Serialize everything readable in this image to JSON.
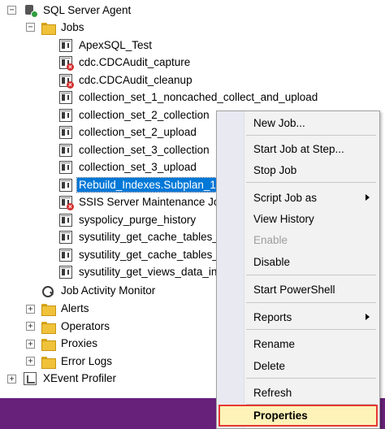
{
  "tree": {
    "agent": {
      "label": "SQL Server Agent",
      "icon": "sql-agent-icon"
    },
    "jobs_folder": {
      "label": "Jobs",
      "icon": "folder-icon"
    },
    "jobs": [
      {
        "label": "ApexSQL_Test",
        "failed": false
      },
      {
        "label": "cdc.CDCAudit_capture",
        "failed": true
      },
      {
        "label": "cdc.CDCAudit_cleanup",
        "failed": true
      },
      {
        "label": "collection_set_1_noncached_collect_and_upload",
        "failed": false
      },
      {
        "label": "collection_set_2_collection",
        "failed": false
      },
      {
        "label": "collection_set_2_upload",
        "failed": false
      },
      {
        "label": "collection_set_3_collection",
        "failed": false
      },
      {
        "label": "collection_set_3_upload",
        "failed": false
      },
      {
        "label": "Rebuild_Indexes.Subplan_1",
        "failed": false,
        "selected": true
      },
      {
        "label": "SSIS Server Maintenance Jo",
        "failed": true
      },
      {
        "label": "syspolicy_purge_history",
        "failed": false
      },
      {
        "label": "sysutility_get_cache_tables_",
        "failed": false
      },
      {
        "label": "sysutility_get_cache_tables_",
        "failed": false
      },
      {
        "label": "sysutility_get_views_data_in",
        "failed": false
      }
    ],
    "job_activity_monitor": {
      "label": "Job Activity Monitor",
      "icon": "monitor-icon"
    },
    "folders": [
      {
        "label": "Alerts"
      },
      {
        "label": "Operators"
      },
      {
        "label": "Proxies"
      },
      {
        "label": "Error Logs"
      }
    ],
    "xevent": {
      "label": "XEvent Profiler",
      "icon": "xevent-icon"
    },
    "expand_symbol": "+",
    "collapse_symbol": "−"
  },
  "context_menu": {
    "items": [
      {
        "label": "New Job...",
        "enabled": true
      },
      {
        "label": "Start Job at Step...",
        "enabled": true
      },
      {
        "label": "Stop Job",
        "enabled": true
      },
      {
        "label": "Script Job as",
        "enabled": true,
        "submenu": true
      },
      {
        "label": "View History",
        "enabled": true
      },
      {
        "label": "Enable",
        "enabled": false
      },
      {
        "label": "Disable",
        "enabled": true
      },
      {
        "label": "Start PowerShell",
        "enabled": true
      },
      {
        "label": "Reports",
        "enabled": true,
        "submenu": true
      },
      {
        "label": "Rename",
        "enabled": true
      },
      {
        "label": "Delete",
        "enabled": true
      },
      {
        "label": "Refresh",
        "enabled": true
      },
      {
        "label": "Properties",
        "enabled": true,
        "highlighted": true
      }
    ]
  },
  "colors": {
    "selection": "#0078d7",
    "highlight_border": "#e53935",
    "highlight_fill": "#fdf2b7",
    "bottom_bar": "#68217a"
  }
}
